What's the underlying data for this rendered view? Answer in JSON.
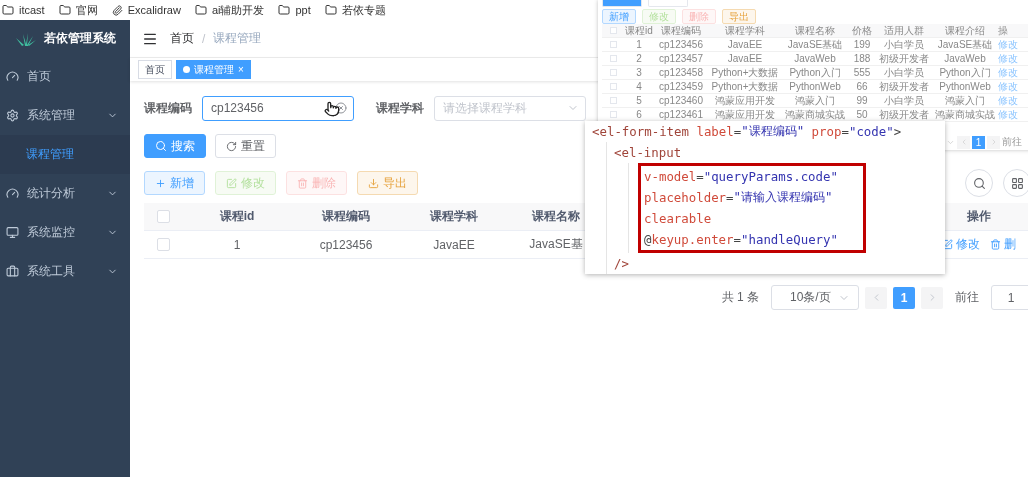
{
  "bookmarks": [
    {
      "label": "itcast",
      "kind": "folder"
    },
    {
      "label": "官网",
      "kind": "folder"
    },
    {
      "label": "Excalidraw",
      "kind": "link"
    },
    {
      "label": "ai辅助开发",
      "kind": "folder"
    },
    {
      "label": "ppt",
      "kind": "folder"
    },
    {
      "label": "若依专题",
      "kind": "folder"
    }
  ],
  "sidebar": {
    "title": "若依管理系统",
    "items": [
      {
        "label": "首页"
      },
      {
        "label": "系统管理",
        "expanded": true,
        "children": [
          {
            "label": "课程管理",
            "selected": true
          }
        ]
      },
      {
        "label": "统计分析"
      },
      {
        "label": "系统监控"
      },
      {
        "label": "系统工具"
      }
    ]
  },
  "breadcrumb": [
    "首页",
    "课程管理"
  ],
  "breadcrumb_separator": "/",
  "tags": [
    {
      "label": "首页",
      "selected": false
    },
    {
      "label": "课程管理",
      "selected": true,
      "close": "×"
    }
  ],
  "form": [
    {
      "label": "课程编码",
      "kind": "input",
      "value": "cp123456"
    },
    {
      "label": "课程学科",
      "kind": "select",
      "placeholder": "请选择课程学科"
    }
  ],
  "form_buttons": [
    {
      "label": "搜索",
      "kind": "primary"
    },
    {
      "label": "重置",
      "kind": "default"
    }
  ],
  "toolbar": [
    {
      "label": "新增",
      "kind": "add",
      "disabled": false
    },
    {
      "label": "修改",
      "kind": "edit",
      "disabled": true
    },
    {
      "label": "删除",
      "kind": "delete",
      "disabled": true
    },
    {
      "label": "导出",
      "kind": "export",
      "disabled": false
    }
  ],
  "table": {
    "all_selected": false,
    "columns": [
      "课程id",
      "课程编码",
      "课程学科",
      "课程名称"
    ],
    "action_column": "操作",
    "rows": [
      {
        "selected": false,
        "cells": [
          "1",
          "cp123456",
          "JavaEE",
          "JavaSE基"
        ],
        "actions": [
          "修改",
          "删"
        ]
      }
    ]
  },
  "pagination": {
    "total": "共 1 条",
    "page_size": "10条/页",
    "pages": [
      {
        "label": "1",
        "selected": true
      }
    ],
    "jump_label": "前往",
    "jump_value": "1"
  },
  "inset": {
    "toolbar": [
      "新增",
      "修改",
      "删除",
      "导出"
    ],
    "columns": [
      "课程id",
      "课程编码",
      "课程学科",
      "课程名称",
      "价格",
      "适用人群",
      "课程介绍",
      "操"
    ],
    "all_selected": false,
    "rows": [
      {
        "selected": false,
        "cells": [
          "1",
          "cp123456",
          "JavaEE",
          "JavaSE基础",
          "199",
          "小白学员",
          "JavaSE基础",
          "修改"
        ]
      },
      {
        "selected": false,
        "cells": [
          "2",
          "cp123457",
          "JavaEE",
          "JavaWeb",
          "188",
          "初级开发者",
          "JavaWeb",
          "修改"
        ]
      },
      {
        "selected": false,
        "cells": [
          "3",
          "cp123458",
          "Python+大数据",
          "Python入门",
          "555",
          "小白学员",
          "Python入门",
          "修改"
        ]
      },
      {
        "selected": false,
        "cells": [
          "4",
          "cp123459",
          "Python+大数据",
          "PythonWeb",
          "66",
          "初级开发者",
          "PythonWeb",
          "修改"
        ]
      },
      {
        "selected": false,
        "cells": [
          "5",
          "cp123460",
          "鸿蒙应用开发",
          "鸿蒙入门",
          "99",
          "小白学员",
          "鸿蒙入门",
          "修改"
        ]
      },
      {
        "selected": false,
        "cells": [
          "6",
          "cp123461",
          "鸿蒙应用开发",
          "鸿蒙商城实战",
          "50",
          "初级开发者",
          "鸿蒙商城实战",
          "修改"
        ]
      }
    ],
    "pages": [
      {
        "label": "1",
        "selected": true
      }
    ],
    "jump_label": "前往"
  },
  "code": {
    "line": [
      {
        "t": "<el-form-item",
        "kind": "tag"
      },
      {
        "t": " label",
        "kind": "attr"
      },
      {
        "t": "=",
        "kind": "punct"
      },
      {
        "t": "\"课程编码\"",
        "kind": "string"
      },
      {
        "t": " prop",
        "kind": "attr"
      },
      {
        "t": "=",
        "kind": "punct"
      },
      {
        "t": "\"code\"",
        "kind": "string"
      },
      {
        "t": ">",
        "kind": "punct"
      }
    ],
    "child": {
      "line": [
        {
          "t": "<el-input",
          "kind": "tag"
        }
      ],
      "highlighted": [
        [
          {
            "t": "v-model",
            "kind": "attr"
          },
          {
            "t": "=",
            "kind": "punct"
          },
          {
            "t": "\"queryParams.code\"",
            "kind": "string"
          }
        ],
        [
          {
            "t": "placeholder",
            "kind": "attr"
          },
          {
            "t": "=",
            "kind": "punct"
          },
          {
            "t": "\"请输入课程编码\"",
            "kind": "string"
          }
        ],
        [
          {
            "t": "clearable",
            "kind": "attr"
          }
        ],
        [
          {
            "t": "@",
            "kind": "punct"
          },
          {
            "t": "keyup.enter",
            "kind": "attr"
          },
          {
            "t": "=",
            "kind": "punct"
          },
          {
            "t": "\"handleQuery\"",
            "kind": "string"
          }
        ]
      ],
      "end": [
        {
          "t": "/>",
          "kind": "tag"
        }
      ]
    }
  }
}
